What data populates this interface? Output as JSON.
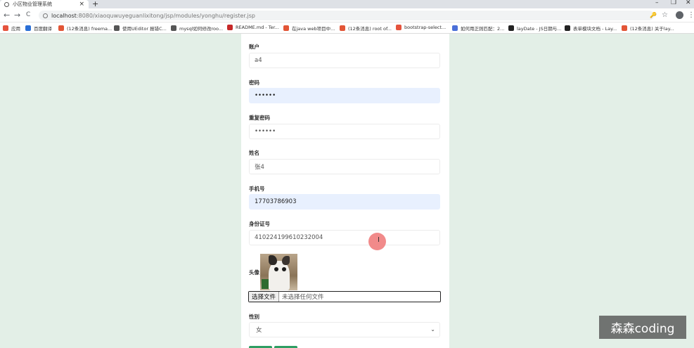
{
  "browser": {
    "tab_title": "小区物业管理系统",
    "tab_close": "×",
    "new_tab": "+",
    "window_controls": [
      "–",
      "❐",
      "✕"
    ],
    "nav_back": "←",
    "nav_forward": "→",
    "nav_reload": "C",
    "url_host": "localhost",
    "url_path": ":8080/xiaoquwuyeguanlixitong/jsp/modules/yonghu/register.jsp",
    "key_icon": "🔑",
    "star_icon": "☆",
    "menu_icon": "⋮",
    "bookmarks": [
      {
        "label": "应用",
        "color": "#e5533d"
      },
      {
        "label": "百度翻译",
        "color": "#2b6fd6"
      },
      {
        "label": "(12条消息) freema...",
        "color": "#e25536"
      },
      {
        "label": "使用UEditor 报错C...",
        "color": "#555555"
      },
      {
        "label": "mysql如何修改roo...",
        "color": "#555555"
      },
      {
        "label": "README.md - Ter...",
        "color": "#c62828"
      },
      {
        "label": "在java web项目中...",
        "color": "#e25536"
      },
      {
        "label": "(12条消息) root of...",
        "color": "#e25536"
      },
      {
        "label": "bootstrap-select...",
        "color": "#e5533d"
      },
      {
        "label": "如何用正则匹配：2...",
        "color": "#4a6fd8"
      },
      {
        "label": "layDate - JS日期与...",
        "color": "#222222"
      },
      {
        "label": "表单模块文档 - Lay...",
        "color": "#222222"
      },
      {
        "label": "(12条消息) 关于lay...",
        "color": "#e25536"
      }
    ]
  },
  "form": {
    "account": {
      "label": "账户",
      "value": "a4"
    },
    "password": {
      "label": "密码",
      "value": "••••••"
    },
    "repeat_password": {
      "label": "重复密码",
      "value": "••••••"
    },
    "name": {
      "label": "姓名",
      "value": "张4"
    },
    "phone": {
      "label": "手机号",
      "value": "17703786903"
    },
    "id_number": {
      "label": "身份证号",
      "value": "410224199610232004"
    },
    "avatar": {
      "label": "头像",
      "choose_button": "选择文件",
      "no_file_text": "未选择任何文件"
    },
    "gender": {
      "label": "性别",
      "value": "女",
      "caret": "⌄"
    }
  },
  "overlay": {
    "cursor_glyph": "I",
    "watermark": "森森coding"
  },
  "colors": {
    "page_background": "#e3efe7",
    "autofill": "#e8f0fe",
    "button_green": "#2e9e63",
    "cursor_dot": "#f08080"
  }
}
